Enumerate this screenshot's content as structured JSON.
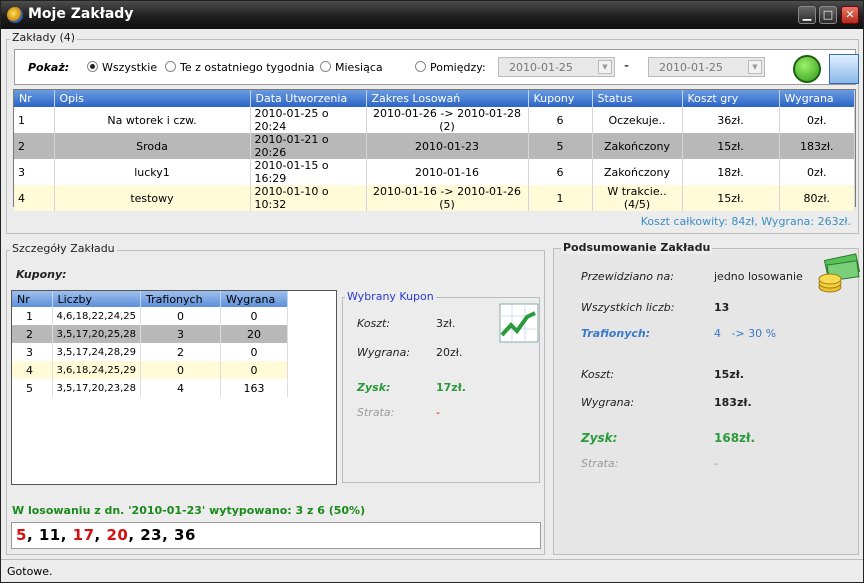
{
  "window": {
    "title": "Moje Zakłady"
  },
  "section_bets": {
    "label": "Zakłady (4)"
  },
  "filter": {
    "show_label": "Pokaż:",
    "options": [
      "Wszystkie",
      "Te z ostatniego tygodnia",
      "Miesiąca",
      "Pomiędzy:"
    ],
    "selected": "Wszystkie",
    "date_from": "2010-01-25",
    "date_to": "2010-01-25",
    "dash": "-"
  },
  "bets_table": {
    "columns": [
      "Nr",
      "Opis",
      "Data Utworzenia",
      "Zakres Losowań",
      "Kupony",
      "Status",
      "Koszt gry",
      "Wygrana"
    ],
    "rows": [
      {
        "nr": "1",
        "opis": "Na wtorek i czw.",
        "data": "2010-01-25  o 20:24",
        "zakres": "2010-01-26 -> 2010-01-28  (2)",
        "kupony": "6",
        "status": "Oczekuje..",
        "koszt": "36zł.",
        "wygrana": "0zł."
      },
      {
        "nr": "2",
        "opis": "Sroda",
        "data": "2010-01-21  o 20:26",
        "zakres": "2010-01-23",
        "kupony": "5",
        "status": "Zakończony",
        "koszt": "15zł.",
        "wygrana": "183zł."
      },
      {
        "nr": "3",
        "opis": "lucky1",
        "data": "2010-01-15  o 16:29",
        "zakres": "2010-01-16",
        "kupony": "6",
        "status": "Zakończony",
        "koszt": "18zł.",
        "wygrana": "0zł."
      },
      {
        "nr": "4",
        "opis": "testowy",
        "data": "2010-01-10  o 10:32",
        "zakres": "2010-01-16 -> 2010-01-26  (5)",
        "kupony": "1",
        "status": "W trakcie..  (4/5)",
        "koszt": "15zł.",
        "wygrana": "80zł."
      }
    ],
    "total": "Koszt całkowity: 84zł,  Wygrana: 263zł."
  },
  "details": {
    "label": "Szczegóły Zakładu",
    "coupons_label": "Kupony:",
    "coupon_columns": [
      "Nr",
      "Liczby",
      "Trafionych",
      "Wygrana"
    ],
    "coupons": [
      {
        "nr": "1",
        "liczby": "4,6,18,22,24,25",
        "trafionych": "0",
        "wygrana": "0"
      },
      {
        "nr": "2",
        "liczby": "3,5,17,20,25,28",
        "trafionych": "3",
        "wygrana": "20"
      },
      {
        "nr": "3",
        "liczby": "3,5,17,24,28,29",
        "trafionych": "2",
        "wygrana": "0"
      },
      {
        "nr": "4",
        "liczby": "3,6,18,24,25,29",
        "trafionych": "0",
        "wygrana": "0"
      },
      {
        "nr": "5",
        "liczby": "3,5,17,20,23,28",
        "trafionych": "4",
        "wygrana": "163"
      }
    ],
    "selected_coupon": {
      "label": "Wybrany Kupon",
      "cost_label": "Koszt:",
      "cost": "3zł.",
      "win_label": "Wygrana:",
      "win": "20zł.",
      "profit_label": "Zysk:",
      "profit": "17zł.",
      "loss_label": "Strata:",
      "loss": "-"
    },
    "draw_info": "W losowaniu z dn. '2010-01-23'  wytypowano:  3 z 6  (50%)",
    "drawn_numbers": [
      {
        "n": "5",
        "hit": true
      },
      {
        "n": "11",
        "hit": false
      },
      {
        "n": "17",
        "hit": true
      },
      {
        "n": "20",
        "hit": true
      },
      {
        "n": "23",
        "hit": false
      },
      {
        "n": "36",
        "hit": false
      }
    ]
  },
  "summary": {
    "label": "Podsumowanie Zakładu",
    "planned_label": "Przewidziano na:",
    "planned": "jedno losowanie",
    "all_label": "Wszystkich liczb:",
    "all": "13",
    "hits_label": "Trafionych:",
    "hits": "4   -> 30 %",
    "cost_label": "Koszt:",
    "cost": "15zł.",
    "win_label": "Wygrana:",
    "win": "183zł.",
    "profit_label": "Zysk:",
    "profit": "168zł.",
    "loss_label": "Strata:",
    "loss": "-"
  },
  "status": {
    "text": "Gotowe."
  },
  "colors": {
    "header": "#2c64c6",
    "accent_green": "#2a9a3a",
    "hit_red": "#d41010",
    "total_blue": "#3b8fc4"
  }
}
